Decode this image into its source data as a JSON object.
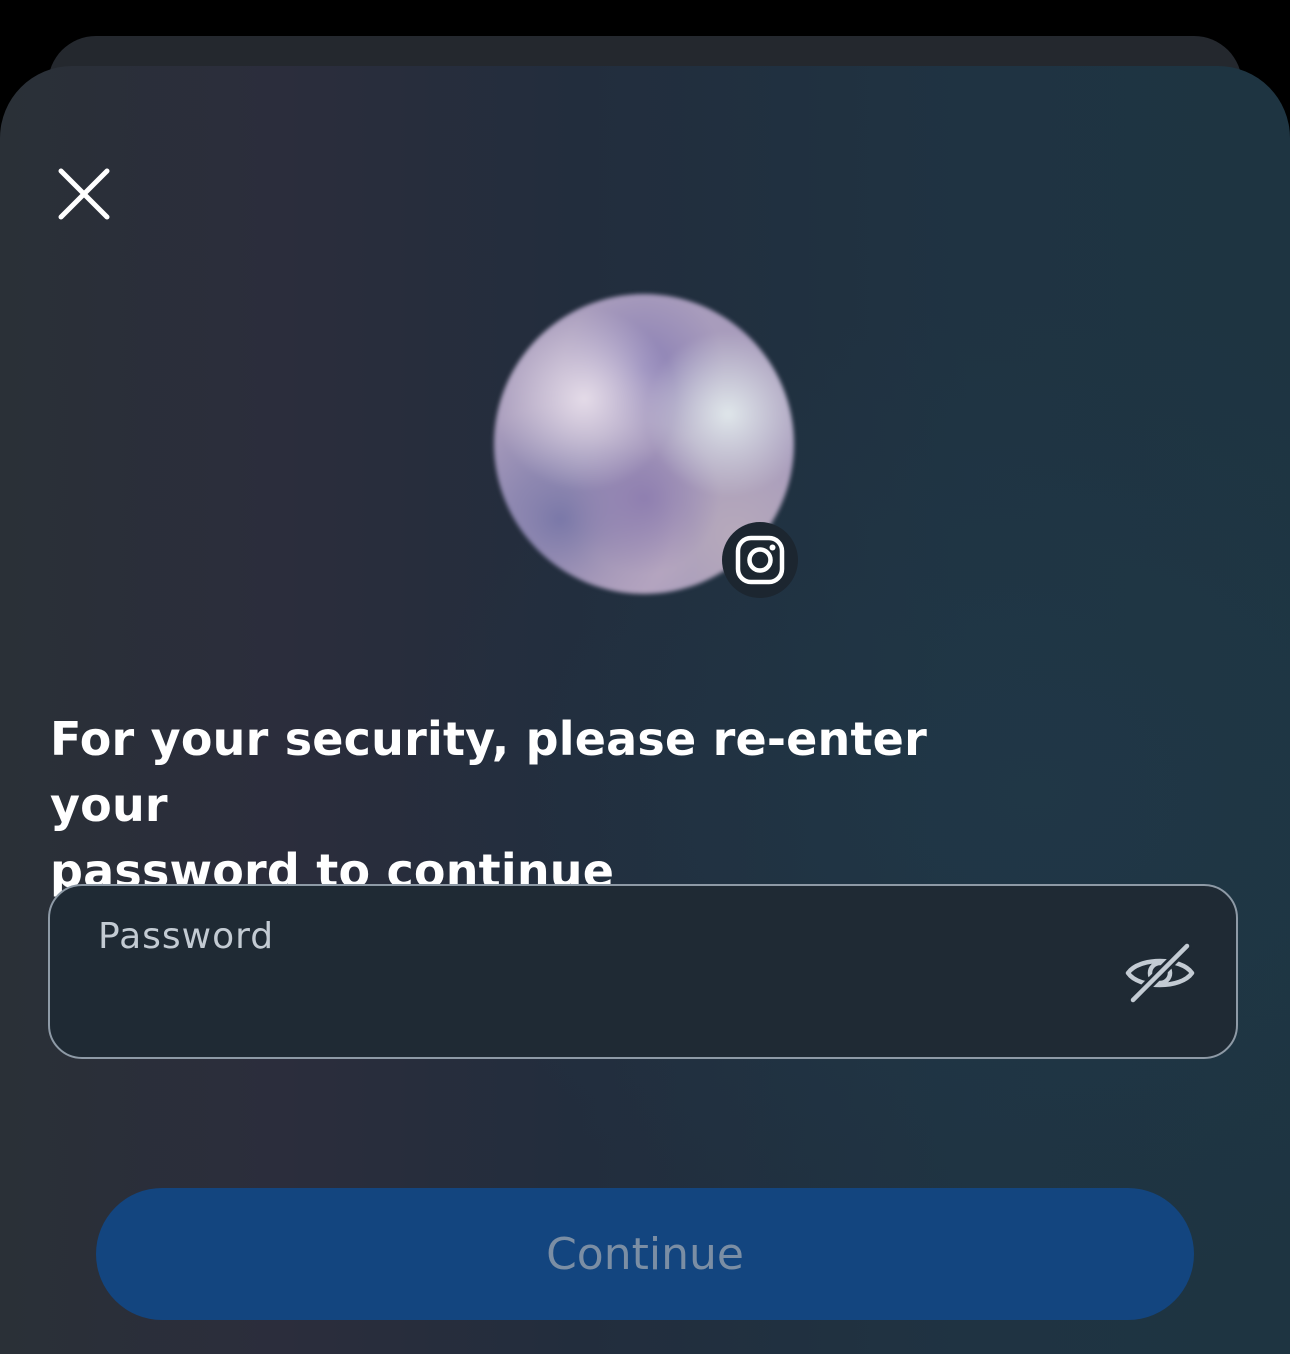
{
  "dialog": {
    "prompt_line1": "For your security, please re-enter your",
    "prompt_line2": "password to continue"
  },
  "avatar": {
    "badge_icon": "instagram-icon"
  },
  "password_field": {
    "label": "Password",
    "value": "",
    "visibility_icon": "eye-slash-icon"
  },
  "continue_button": {
    "label": "Continue"
  },
  "colors": {
    "button_bg": "#13457f",
    "button_text_disabled": "#7b8ea4",
    "field_border": "#8e9aa6"
  }
}
